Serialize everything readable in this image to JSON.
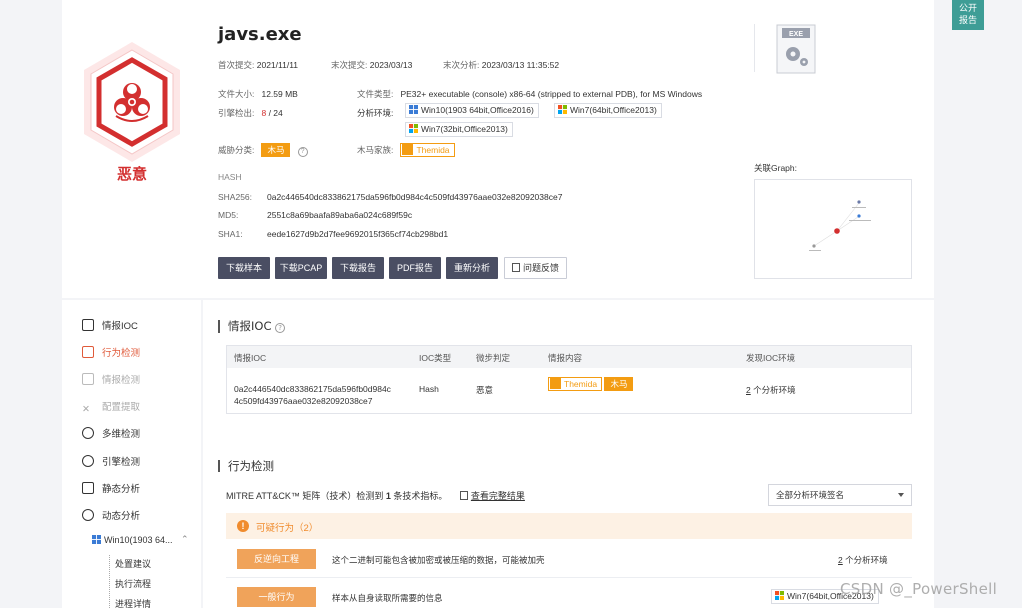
{
  "file": {
    "name": "javs.exe",
    "first_submit_label": "首次提交:",
    "first_submit": "2021/11/11",
    "last_submit_label": "末次提交:",
    "last_submit": "2023/03/13",
    "last_analysis_label": "末次分析:",
    "last_analysis": "2023/03/13 11:35:52",
    "size_label": "文件大小:",
    "size": "12.59 MB",
    "type_label": "文件类型:",
    "type": "PE32+ executable (console) x86-64 (stripped to external PDB), for MS Windows",
    "engine_label": "引擎检出:",
    "engine_hits": "8",
    "engine_sep": " / ",
    "engine_total": "24",
    "env_label": "分析环境:",
    "envs": [
      "Win10(1903 64bit,Office2016)",
      "Win7(64bit,Office2013)",
      "Win7(32bit,Office2013)"
    ],
    "threat_label": "威胁分类:",
    "threat": "木马",
    "family_label": "木马家族:",
    "family": "Themida",
    "verdict": "恶意",
    "exe_icon_text": "EXE"
  },
  "hash": {
    "title": "HASH",
    "sha256_label": "SHA256:",
    "sha256": "0a2c446540dc833862175da596fb0d984c4c509fd43976aae032e82092038ce7",
    "md5_label": "MD5:",
    "md5": "2551c8a69baafa89aba6a024c689f59c",
    "sha1_label": "SHA1:",
    "sha1": "eede1627d9b2d7fee9692015f365cf74cb298bd1"
  },
  "actions": {
    "download_sample": "下载样本",
    "download_pcap": "下载PCAP",
    "download_report": "下载报告",
    "pdf_report": "PDF报告",
    "reanalyze": "重新分析",
    "feedback": "问题反馈"
  },
  "graph": {
    "title": "关联Graph:"
  },
  "public_report": {
    "line1": "公开",
    "line2": "报告"
  },
  "sidebar": {
    "items": [
      {
        "label": "情报IOC"
      },
      {
        "label": "行为检测"
      },
      {
        "label": "情报检测"
      },
      {
        "label": "配置提取"
      },
      {
        "label": "多维检测"
      },
      {
        "label": "引擎检测"
      },
      {
        "label": "静态分析"
      },
      {
        "label": "动态分析"
      }
    ],
    "env_node": "Win10(1903 64...",
    "sub_items": [
      "处置建议",
      "执行流程",
      "进程详情"
    ]
  },
  "ioc": {
    "title": "情报IOC",
    "columns": [
      "情报IOC",
      "IOC类型",
      "微步判定",
      "情报内容",
      "发现IOC环境"
    ],
    "row": {
      "ioc_line1": "0a2c446540dc833862175da596fb0d984c",
      "ioc_line2": "4c509fd43976aae032e82092038ce7",
      "type": "Hash",
      "verdict": "恶意",
      "tag_family": "Themida",
      "tag_threat": "木马",
      "env_count": "2",
      "env_suffix": " 个分析环境"
    }
  },
  "behavior": {
    "title": "行为检测",
    "mitre_prefix": "MITRE ATT&CK™ 矩阵（技术）检测到 ",
    "mitre_count": "1",
    "mitre_suffix": " 条技术指标。",
    "view_full": "查看完整结果",
    "select_value": "全部分析环境签名",
    "suspicious_label": "可疑行为（2）",
    "rows": [
      {
        "tag": "反逆向工程",
        "desc": "这个二进制可能包含被加密或被压缩的数据，可能被加壳",
        "env_count": "2",
        "env_suffix": " 个分析环境"
      },
      {
        "tag": "一般行为",
        "desc": "样本从自身读取所需要的信息",
        "env": "Win7(64bit,Office2013)"
      }
    ]
  },
  "watermark": "CSDN @_PowerShell",
  "colors": {
    "brand_dark": "#4a4e63",
    "malicious_red": "#d32f2f",
    "accent_orange": "#f39c12",
    "public_teal": "#3e9d96",
    "sidebar_active": "#e05a3a"
  }
}
